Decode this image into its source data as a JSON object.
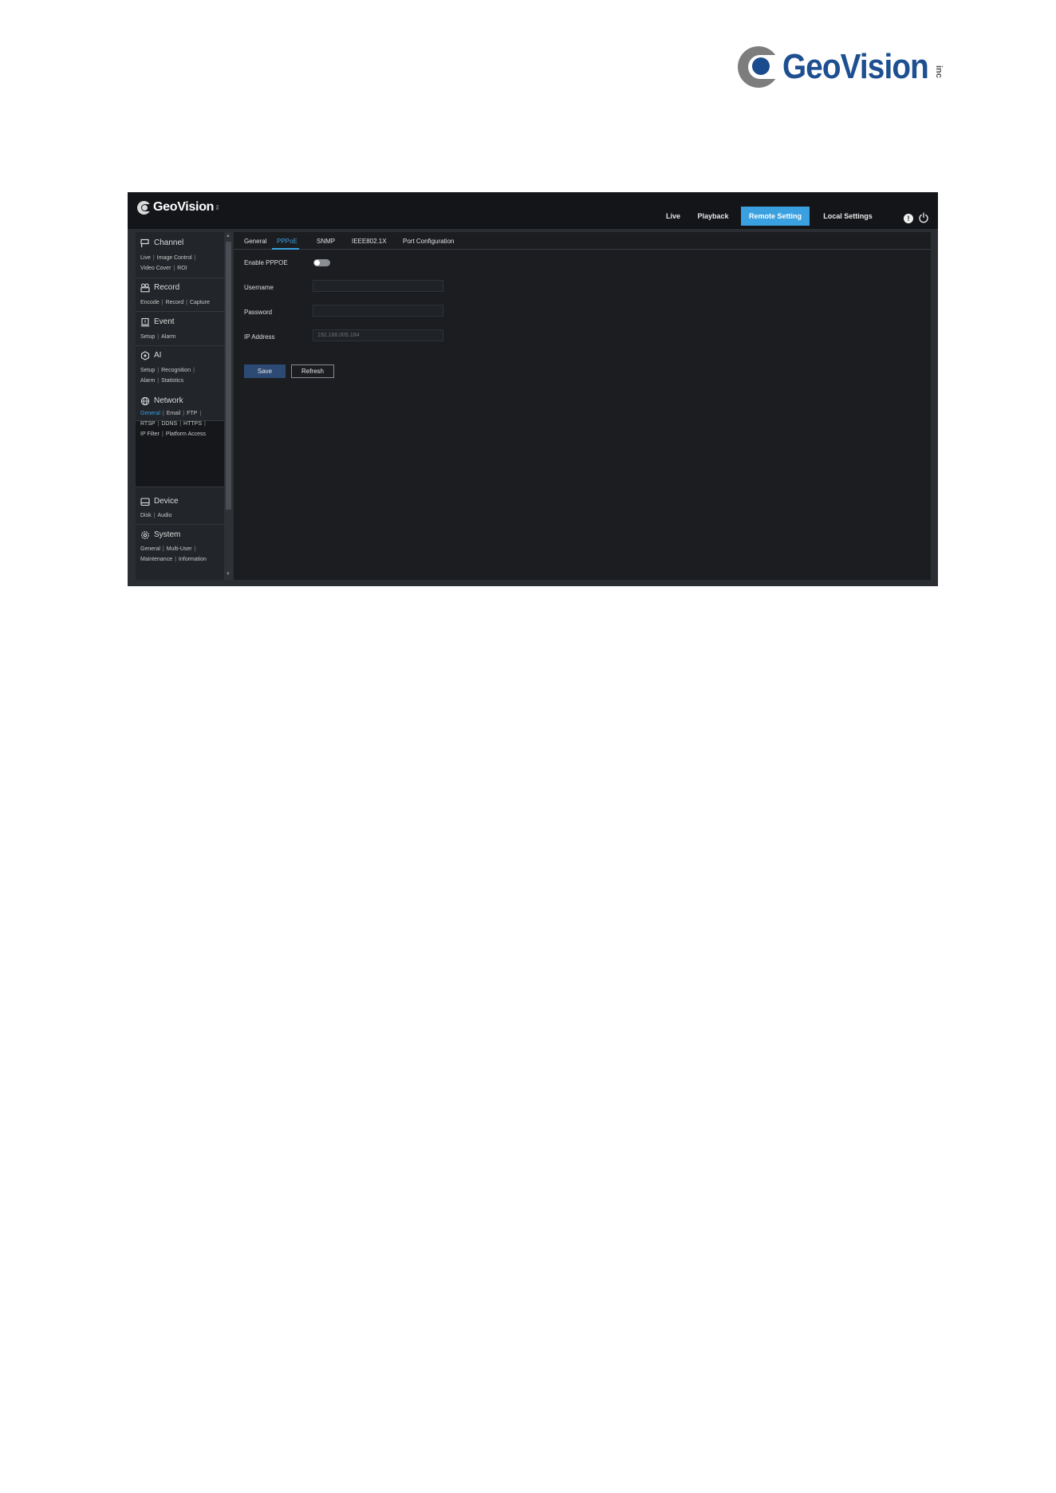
{
  "page": {
    "logo_text": "GeoVision",
    "logo_suffix": "inc"
  },
  "app": {
    "logo_text": "GeoVision",
    "logo_suffix": "inc",
    "nav": {
      "live": "Live",
      "playback": "Playback",
      "remote_setting": "Remote Setting",
      "local_settings": "Local Settings"
    },
    "alert_glyph": "!",
    "sidebar": {
      "channel": {
        "title": "Channel",
        "links": [
          "Live",
          "Image Control",
          "Video Cover",
          "ROI"
        ]
      },
      "record": {
        "title": "Record",
        "links": [
          "Encode",
          "Record",
          "Capture"
        ]
      },
      "event": {
        "title": "Event",
        "links": [
          "Setup",
          "Alarm"
        ]
      },
      "ai": {
        "title": "AI",
        "links": [
          "Setup",
          "Recognition",
          "Alarm",
          "Statistics"
        ]
      },
      "network": {
        "title": "Network",
        "links": [
          "General",
          "Email",
          "FTP",
          "RTSP",
          "DDNS",
          "HTTPS",
          "IP Filter",
          "Platform Access"
        ]
      },
      "device": {
        "title": "Device",
        "links": [
          "Disk",
          "Audio"
        ]
      },
      "system": {
        "title": "System",
        "links": [
          "General",
          "Multi-User",
          "Maintenance",
          "Information"
        ]
      }
    },
    "tabs": [
      "General",
      "PPPoE",
      "SNMP",
      "IEEE802.1X",
      "Port Configuration"
    ],
    "form": {
      "enable_label": "Enable PPPOE",
      "enable_value": false,
      "username_label": "Username",
      "username_value": "",
      "password_label": "Password",
      "password_value": "",
      "ip_label": "IP Address",
      "ip_value": "192.168.005.184"
    },
    "buttons": {
      "save": "Save",
      "refresh": "Refresh"
    },
    "colors": {
      "accent": "#3aa0e0",
      "save_button": "#2c4a74",
      "topbar": "#131518"
    }
  }
}
